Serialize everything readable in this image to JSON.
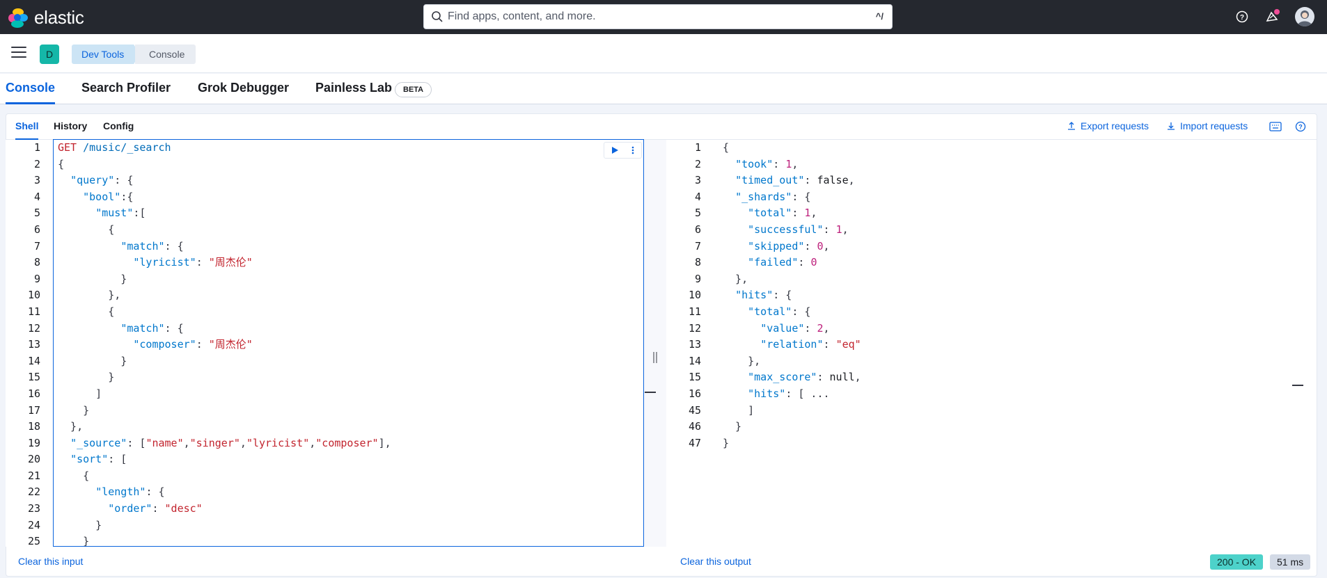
{
  "header": {
    "logo_text": "elastic",
    "search_placeholder": "Find apps, content, and more.",
    "search_shortcut": "^/"
  },
  "breadcrumb": {
    "space_initial": "D",
    "items": [
      "Dev Tools",
      "Console"
    ]
  },
  "tabs": [
    "Console",
    "Search Profiler",
    "Grok Debugger",
    "Painless Lab"
  ],
  "tab_badge": "BETA",
  "subtabs": [
    "Shell",
    "History",
    "Config"
  ],
  "actions": {
    "export": "Export requests",
    "import": "Import requests"
  },
  "request": {
    "line_numbers": [
      "1",
      "2",
      "3",
      "4",
      "5",
      "6",
      "7",
      "8",
      "9",
      "10",
      "11",
      "12",
      "13",
      "14",
      "15",
      "16",
      "17",
      "18",
      "19",
      "20",
      "21",
      "22",
      "23",
      "24",
      "25"
    ],
    "lines": [
      "GET /music/_search",
      "{",
      "  \"query\": {",
      "    \"bool\":{",
      "      \"must\":[",
      "        {",
      "          \"match\": {",
      "            \"lyricist\": \"周杰伦\"",
      "          }",
      "        },",
      "        {",
      "          \"match\": {",
      "            \"composer\": \"周杰伦\"",
      "          }",
      "        }",
      "      ]",
      "    }",
      "  },",
      "  \"_source\": [\"name\",\"singer\",\"lyricist\",\"composer\"],",
      "  \"sort\": [",
      "    {",
      "      \"length\": {",
      "        \"order\": \"desc\"",
      "      }",
      "    }"
    ]
  },
  "response": {
    "line_numbers": [
      "1",
      "2",
      "3",
      "4",
      "5",
      "6",
      "7",
      "8",
      "9",
      "10",
      "11",
      "12",
      "13",
      "14",
      "15",
      "16",
      "45",
      "46",
      "47"
    ],
    "lines": [
      "{",
      "  \"took\": 1,",
      "  \"timed_out\": false,",
      "  \"_shards\": {",
      "    \"total\": 1,",
      "    \"successful\": 1,",
      "    \"skipped\": 0,",
      "    \"failed\": 0",
      "  },",
      "  \"hits\": {",
      "    \"total\": {",
      "      \"value\": 2,",
      "      \"relation\": \"eq\"",
      "    },",
      "    \"max_score\": null,",
      "    \"hits\": [ ...",
      "    ]",
      "  }",
      "}"
    ]
  },
  "footer": {
    "clear_input": "Clear this input",
    "clear_output": "Clear this output",
    "status": "200 - OK",
    "duration": "51 ms"
  },
  "colors": {
    "accent": "#0b64dd",
    "topbar": "#25282f",
    "status_ok": "#4dd2ca"
  }
}
